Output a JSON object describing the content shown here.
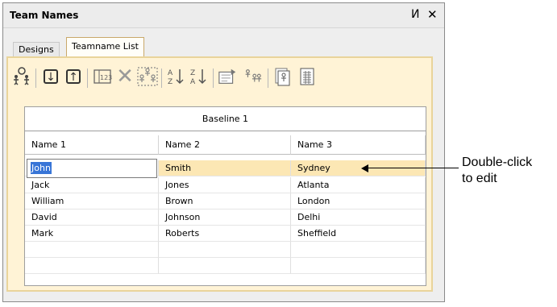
{
  "panel": {
    "title": "Team Names",
    "pin_glyph": "И",
    "close_glyph": "✕"
  },
  "tabs": [
    {
      "label": "Designs",
      "active": false
    },
    {
      "label": "Teamname List",
      "active": true
    }
  ],
  "toolbar_icons": [
    "add-person-icon",
    "move-down-icon",
    "move-up-icon",
    "numbering-icon",
    "delete-icon",
    "select-all-icon",
    "sort-ascending-icon",
    "sort-descending-icon",
    "properties-icon",
    "team-settings-icon",
    "import-icon",
    "export-icon"
  ],
  "grid": {
    "baseline": "Baseline 1",
    "columns": [
      "Name 1",
      "Name 2",
      "Name 3"
    ],
    "rows": [
      [
        "John",
        "Smith",
        "Sydney"
      ],
      [
        "Jack",
        "Jones",
        "Atlanta"
      ],
      [
        "William",
        "Brown",
        "London"
      ],
      [
        "David",
        "Johnson",
        "Delhi"
      ],
      [
        "Mark",
        "Roberts",
        "Sheffield"
      ],
      [
        "",
        "",
        ""
      ],
      [
        "",
        "",
        ""
      ]
    ]
  },
  "callout": {
    "line1": "Double-click",
    "line2": "to edit"
  },
  "colors": {
    "selected_row": "#fce7b4",
    "tab_frame": "#e9d49b",
    "text_selection": "#3875d7"
  }
}
